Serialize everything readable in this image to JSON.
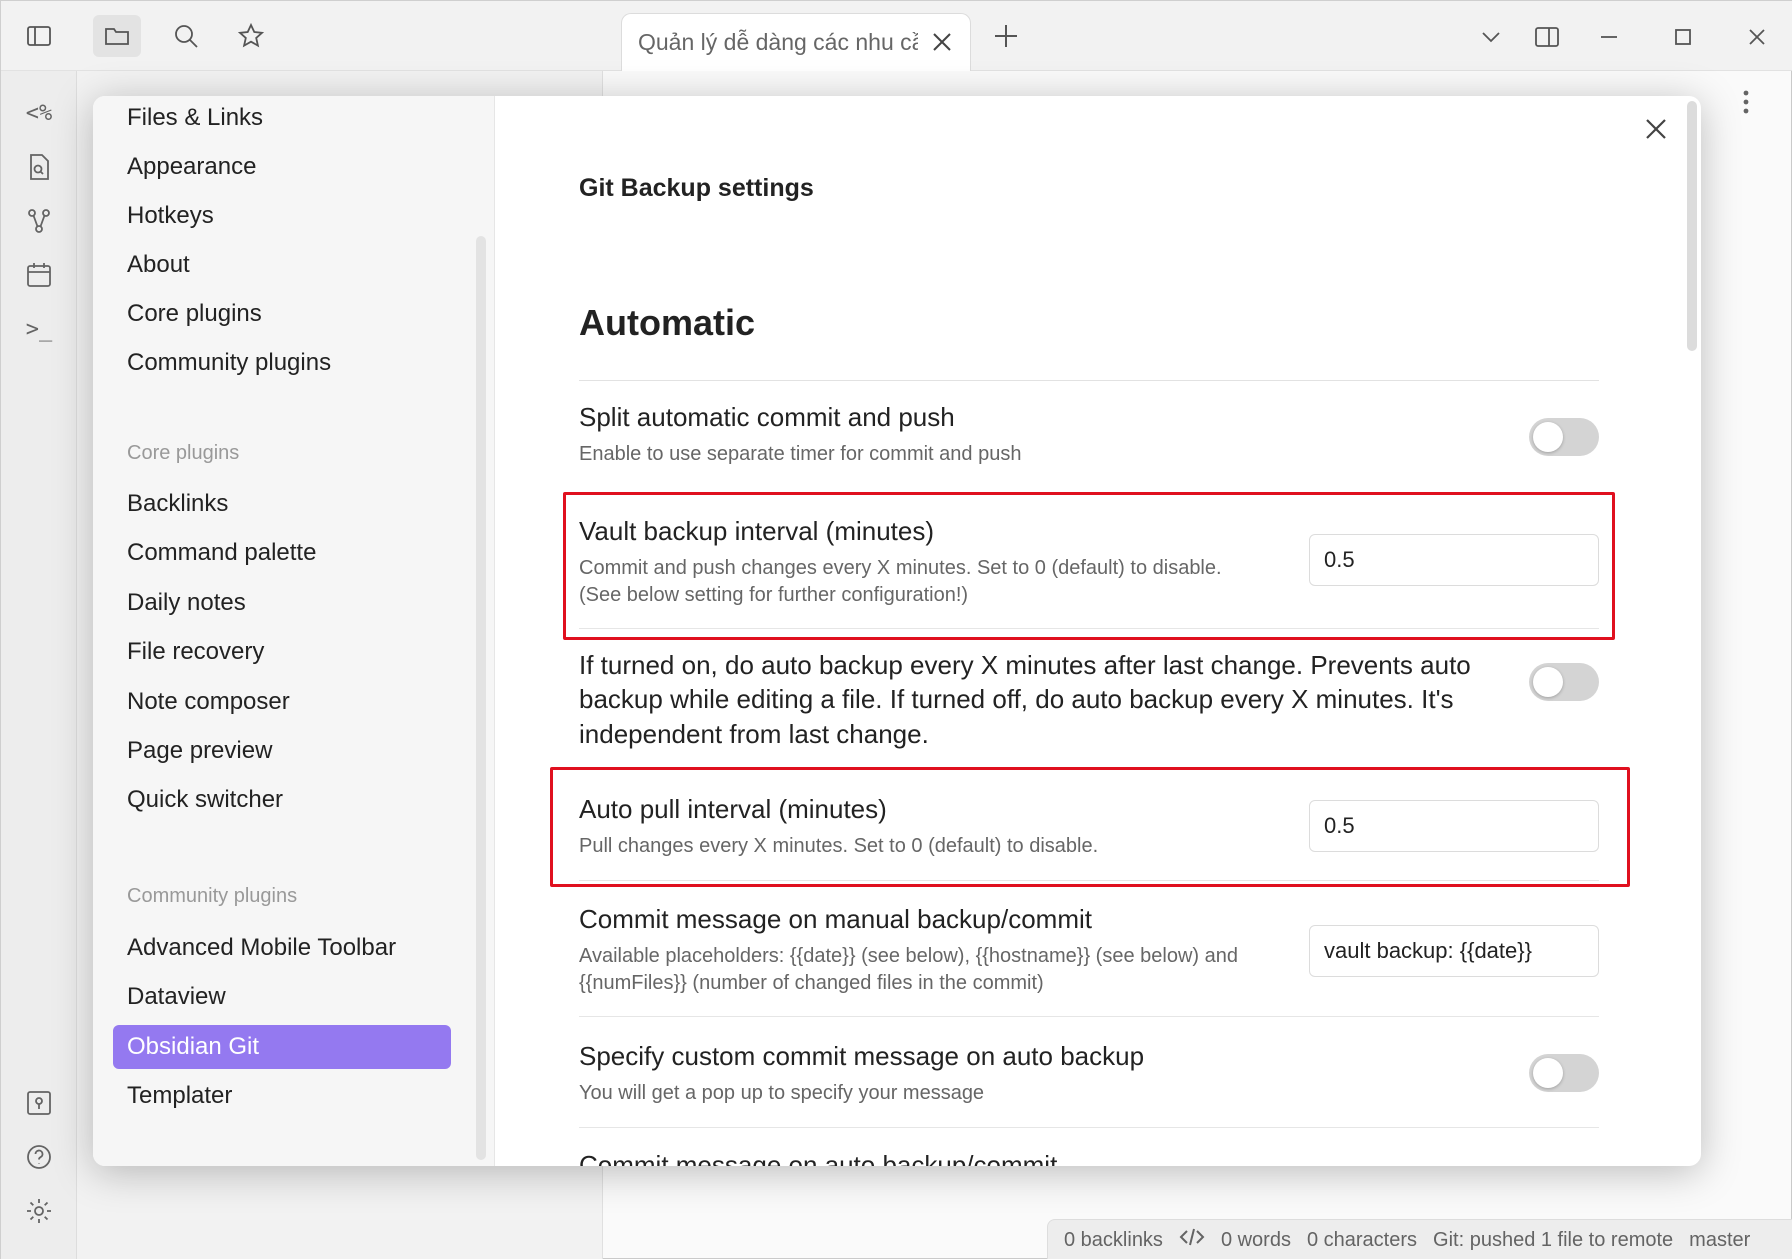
{
  "tab": {
    "title": "Quản lý dễ dàng các nhu cầu"
  },
  "sidebar": {
    "options": [
      "Files & Links",
      "Appearance",
      "Hotkeys",
      "About",
      "Core plugins",
      "Community plugins"
    ],
    "core_heading": "Core plugins",
    "core_plugins": [
      "Backlinks",
      "Command palette",
      "Daily notes",
      "File recovery",
      "Note composer",
      "Page preview",
      "Quick switcher"
    ],
    "community_heading": "Community plugins",
    "community_plugins": [
      "Advanced Mobile Toolbar",
      "Dataview",
      "Obsidian Git",
      "Templater"
    ],
    "active": "Obsidian Git"
  },
  "settings": {
    "plugin_title": "Git Backup settings",
    "section_title": "Automatic",
    "items": [
      {
        "name": "Split automatic commit and push",
        "desc": "Enable to use separate timer for commit and push",
        "type": "toggle",
        "on": false
      },
      {
        "name": "Vault backup interval (minutes)",
        "desc": "Commit and push changes every X minutes. Set to 0 (default) to disable. (See below setting for further configuration!)",
        "type": "text",
        "value": "0.5"
      },
      {
        "name": "If turned on, do auto backup every X minutes after last change. Prevents auto backup while editing a file. If turned off, do auto backup every X minutes. It's independent from last change.",
        "desc": "",
        "type": "toggle",
        "on": false
      },
      {
        "name": "Auto pull interval (minutes)",
        "desc": "Pull changes every X minutes. Set to 0 (default) to disable.",
        "type": "text",
        "value": "0.5"
      },
      {
        "name": "Commit message on manual backup/commit",
        "desc": "Available placeholders: {{date}} (see below), {{hostname}} (see below) and {{numFiles}} (number of changed files in the commit)",
        "type": "text",
        "value": "vault backup: {{date}}"
      },
      {
        "name": "Specify custom commit message on auto backup",
        "desc": "You will get a pop up to specify your message",
        "type": "toggle",
        "on": false
      },
      {
        "name": "Commit message on auto backup/commit",
        "desc": "",
        "type": "text",
        "value": ""
      }
    ]
  },
  "ribbon": {
    "template_glyph": "<%",
    "terminal_glyph": ">_"
  },
  "statusbar": {
    "backlinks": "0 backlinks",
    "words": "0 words",
    "characters": "0 characters",
    "git": "Git: pushed 1 file to remote",
    "branch": "master"
  },
  "colors": {
    "accent": "#9479f0",
    "highlight": "#e0101f"
  }
}
